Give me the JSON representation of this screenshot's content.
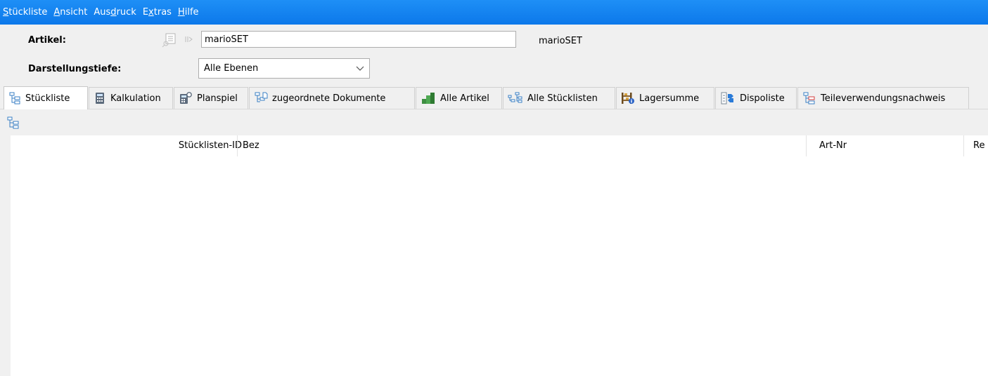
{
  "menubar": {
    "items": [
      {
        "label": "Stückliste",
        "mnemonic": "S",
        "rest": "tückliste"
      },
      {
        "label": "Ansicht",
        "mnemonic": "A",
        "rest": "nsicht"
      },
      {
        "label": "Ausdruck",
        "mnemonic_prefix": "Aus",
        "mnemonic": "d",
        "rest": "ruck"
      },
      {
        "label": "Extras",
        "mnemonic_prefix": "E",
        "mnemonic": "x",
        "rest": "tras"
      },
      {
        "label": "Hilfe",
        "mnemonic": "H",
        "rest": "ilfe"
      }
    ]
  },
  "form": {
    "artikel_label": "Artikel:",
    "artikel_value": "marioSET",
    "artikel_bezeichnung": "marioSET",
    "darstellungstiefe_label": "Darstellungstiefe:",
    "darstellungstiefe_value": "Alle Ebenen"
  },
  "tabs": [
    {
      "label": "Stückliste",
      "icon": "tree-icon",
      "active": true
    },
    {
      "label": "Kalkulation",
      "icon": "calculator-icon"
    },
    {
      "label": "Planspiel",
      "icon": "calculator-gear-icon"
    },
    {
      "label": "zugeordnete Dokumente",
      "icon": "document-tree-icon"
    },
    {
      "label": "Alle Artikel",
      "icon": "green-stairs-icon"
    },
    {
      "label": "Alle Stücklisten",
      "icon": "multi-tree-icon"
    },
    {
      "label": "Lagersumme",
      "icon": "shelf-info-icon"
    },
    {
      "label": "Dispoliste",
      "icon": "dispo-arrows-icon"
    },
    {
      "label": "Teileverwendungsnachweis",
      "icon": "tree-red-icon"
    }
  ],
  "table": {
    "columns": [
      "Stücklisten-ID",
      "Bez",
      "Art-Nr",
      "Re"
    ]
  },
  "colors": {
    "menubar": "#0c78ea",
    "background": "#f0f0f0"
  }
}
